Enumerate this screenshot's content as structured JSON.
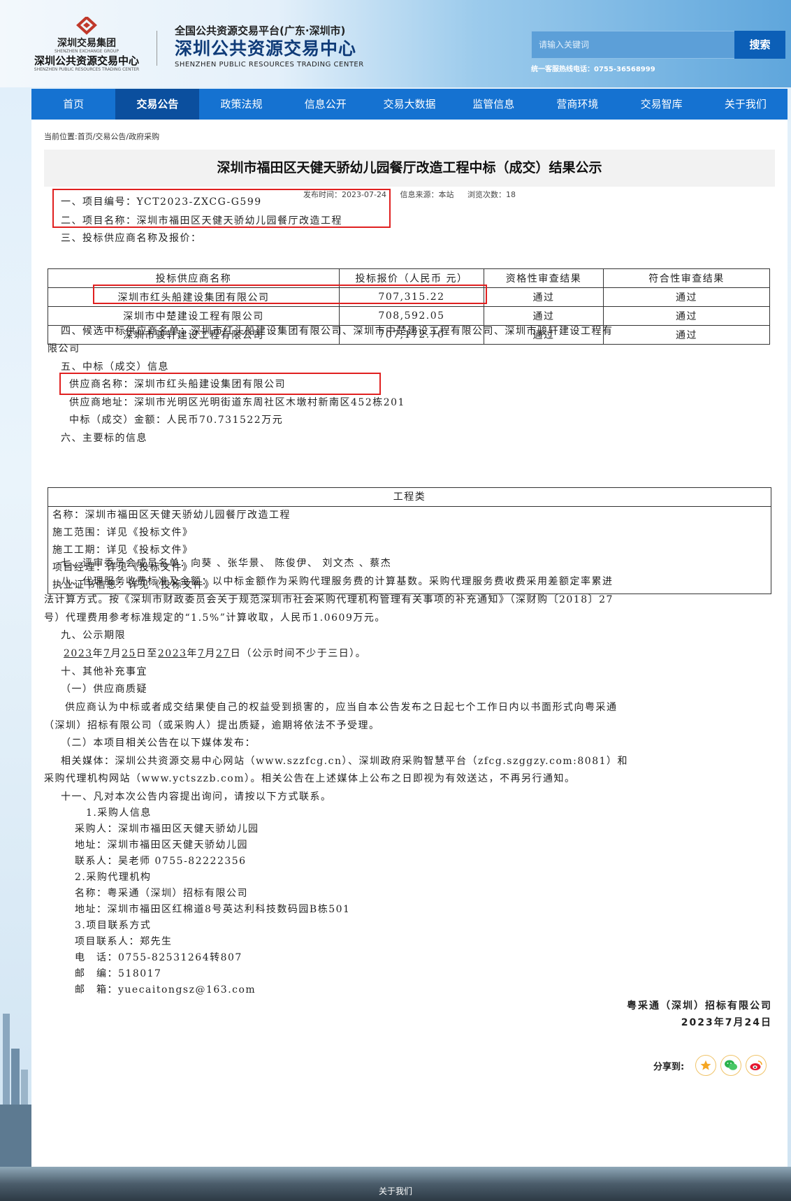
{
  "header": {
    "logo_group_cn": "深圳交易集团",
    "logo_group_en": "SHENZHEN EXCHANGE GROUP",
    "logo_center_cn": "深圳公共资源交易中心",
    "logo_center_en": "SHENZHEN PUBLIC RESOURCES TRADING CENTER",
    "platform_line": "全国公共资源交易平台(广东·深圳市)",
    "center_name": "深圳公共资源交易中心",
    "center_name_en": "SHENZHEN PUBLIC RESOURCES TRADING CENTER",
    "search_placeholder": "请输入关键词",
    "search_button": "搜索",
    "hotline": "统一客服热线电话：0755-36568999"
  },
  "nav": {
    "items": [
      "首页",
      "交易公告",
      "政策法规",
      "信息公开",
      "交易大数据",
      "监管信息",
      "营商环境",
      "交易智库",
      "关于我们"
    ],
    "active_index": 1
  },
  "breadcrumb": "当前位置:首页/交易公告/政府采购",
  "article": {
    "title": "深圳市福田区天健天骄幼儿园餐厅改造工程中标（成交）结果公示",
    "publish_time": "发布时间：2023-07-24",
    "source": "信息来源：本站",
    "views": "浏览次数：18",
    "lines": {
      "l1": "一、项目编号：YCT2023-ZXCG-G599",
      "l2": "二、项目名称：深圳市福田区天健天骄幼儿园餐厅改造工程",
      "l3": "三、投标供应商名称及报价：",
      "l4a": "四、候选中标供应商名单：深圳市红头船建设集团有限公司、深圳市中楚建设工程有限公司、深圳市骏轩建设工程有",
      "l4b": "限公司",
      "l5": "五、中标（成交）信息",
      "l5a": "供应商名称：深圳市红头船建设集团有限公司",
      "l5b": "供应商地址：深圳市光明区光明街道东周社区木墩村新南区452栋201",
      "l5c": "中标（成交）金额：人民币70.731522万元",
      "l6": "六、主要标的信息",
      "l7": "七、评审委员会成员名单：向葵 、张华景、 陈俊伊、 刘文杰 、蔡杰",
      "l8a": "八、代理服务收费标准及金额：以中标金额作为采购代理服务费的计算基数。采购代理服务费收费采用差额定率累进",
      "l8b": "法计算方式。按《深圳市财政委员会关于规范深圳市社会采购代理机构管理有关事项的补充通知》（深财购〔2018〕27",
      "l8c": "号）代理费用参考标准规定的“1.5%”计算收取，人民币1.0609万元。",
      "l9": "九、公示期限",
      "l9_y1": "2023",
      "l9_m1": "7",
      "l9_d1": "25",
      "l9_y2": "2023",
      "l9_m2": "7",
      "l9_d2": "27",
      "l9_tail": "日（公示时间不少于三日）。",
      "l10": "十、其他补充事宜",
      "l10a": "（一）供应商质疑",
      "l10b": "供应商认为中标或者成交结果使自己的权益受到损害的，应当自本公告发布之日起七个工作日内以书面形式向粤采通",
      "l10c": "（深圳）招标有限公司（或采购人）提出质疑，逾期将依法不予受理。",
      "l10d": "（二）本项目相关公告在以下媒体发布：",
      "l10e": "相关媒体：深圳公共资源交易中心网站（www.szzfcg.cn）、深圳政府采购智慧平台（zfcg.szggzy.com:8081）和",
      "l10f": "采购代理机构网站（www.yctszzb.com）。相关公告在上述媒体上公布之日即视为有效送达，不再另行通知。",
      "l11": "十一、凡对本次公告内容提出询问，请按以下方式联系。",
      "c1": "1.采购人信息",
      "c1a": "采购人：深圳市福田区天健天骄幼儿园",
      "c1b": "地址：深圳市福田区天健天骄幼儿园",
      "c1c": "联系人：吴老师 0755-82222356",
      "c2": "2.采购代理机构",
      "c2a": "名称：粤采通（深圳）招标有限公司",
      "c2b": "地址：深圳市福田区红棉道8号英达利科技数码园B栋501",
      "c3": "3.项目联系方式",
      "c3a": "项目联系人：郑先生",
      "c3b": "电　话：0755-82531264转807",
      "c3c": "邮　编：518017",
      "c3d": "邮　箱：yuecaitongsz@163.com"
    },
    "bid_table": {
      "headers": [
        "投标供应商名称",
        "投标报价（人民币 元）",
        "资格性审查结果",
        "符合性审查结果"
      ],
      "rows": [
        [
          "深圳市红头船建设集团有限公司",
          "707,315.22",
          "通过",
          "通过"
        ],
        [
          "深圳市中楚建设工程有限公司",
          "708,592.05",
          "通过",
          "通过"
        ],
        [
          "深圳市骏轩建设工程有限公司",
          "707,172.70",
          "通过",
          "通过"
        ]
      ]
    },
    "engineering": {
      "header": "工程类",
      "rows": [
        "名称：深圳市福田区天健天骄幼儿园餐厅改造工程",
        "施工范围：详见《投标文件》",
        "施工工期：详见《投标文件》",
        "项目经理：详见《投标文件》",
        "执业证书信息：详见《投标文件》"
      ]
    },
    "signature_company": "粤采通（深圳）招标有限公司",
    "signature_date": "2023年7月24日",
    "share_label": "分享到:"
  },
  "footer": {
    "link": "关于我们"
  }
}
